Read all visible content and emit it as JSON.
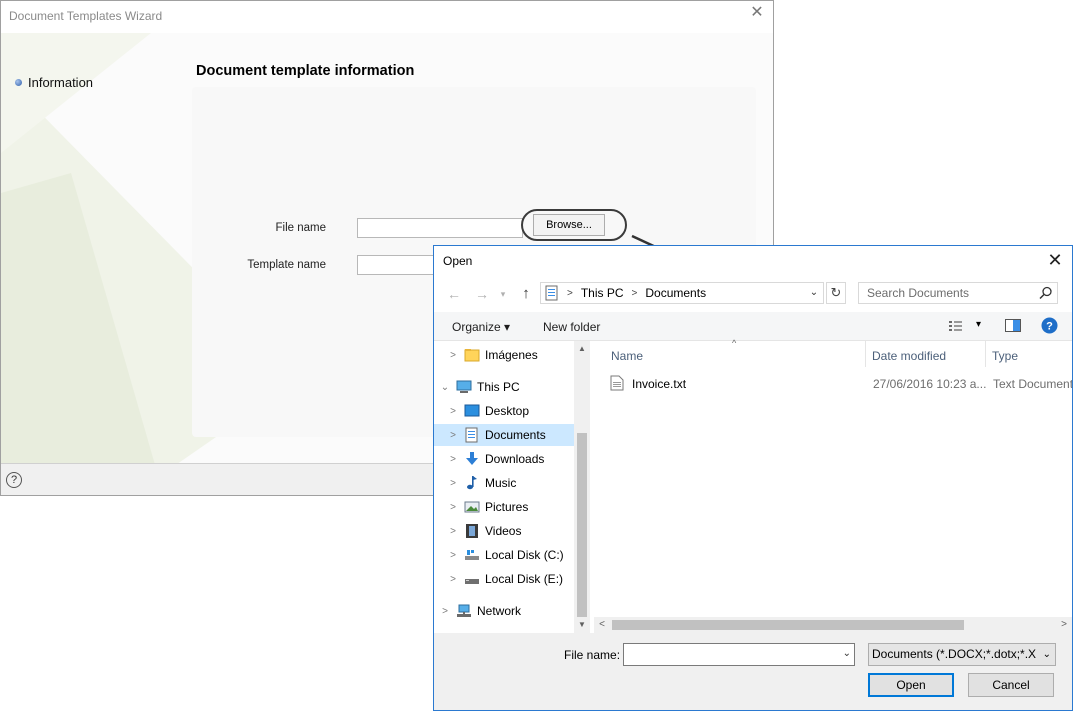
{
  "wizard": {
    "title": "Document Templates Wizard",
    "close_glyph": "✕",
    "step": "Information",
    "page_title": "Document template information",
    "file_name_label": "File name",
    "template_name_label": "Template name",
    "browse_label": "Browse...",
    "help_glyph": "?"
  },
  "dialog": {
    "title": "Open",
    "close_glyph": "✕",
    "back_glyph": "←",
    "forward_glyph": "→",
    "up_glyph": "↑",
    "refresh_glyph": "↻",
    "breadcrumb": [
      "This PC",
      "Documents"
    ],
    "search_placeholder": "Search Documents",
    "toolbar": {
      "organize": "Organize ▾",
      "new_folder": "New folder"
    },
    "nav": [
      {
        "label": "Imágenes",
        "icon": "folder-icon"
      },
      {
        "label": "This PC",
        "icon": "computer-icon"
      },
      {
        "label": "Desktop",
        "icon": "desktop-icon"
      },
      {
        "label": "Documents",
        "icon": "documents-icon",
        "selected": true
      },
      {
        "label": "Downloads",
        "icon": "downloads-icon"
      },
      {
        "label": "Music",
        "icon": "music-icon"
      },
      {
        "label": "Pictures",
        "icon": "pictures-icon"
      },
      {
        "label": "Videos",
        "icon": "videos-icon"
      },
      {
        "label": "Local Disk (C:)",
        "icon": "local-disk-c-icon"
      },
      {
        "label": "Local Disk (E:)",
        "icon": "local-disk-e-icon"
      },
      {
        "label": "Network",
        "icon": "network-icon"
      }
    ],
    "columns": [
      "Name",
      "Date modified",
      "Type"
    ],
    "files": [
      {
        "name": "Invoice.txt",
        "date": "27/06/2016 10:23 a...",
        "type": "Text Document"
      }
    ],
    "file_name_label": "File name:",
    "file_name_value": "",
    "filter": "Documents  (*.DOCX;*.dotx;*.X",
    "open_label": "Open",
    "cancel_label": "Cancel"
  },
  "colors": {
    "accent": "#0078d7",
    "selected": "#cce8ff",
    "dialog_border": "#2b79d0"
  }
}
